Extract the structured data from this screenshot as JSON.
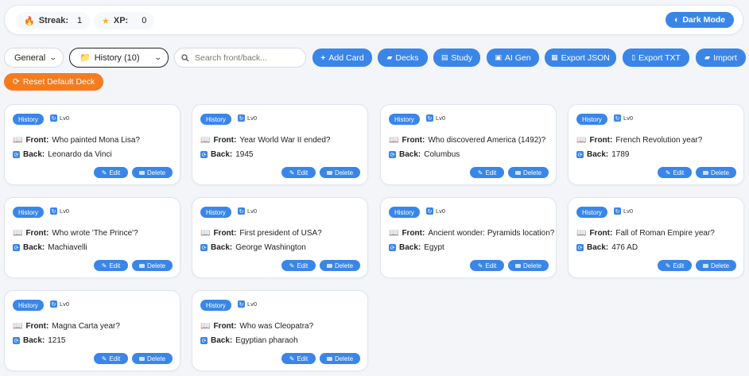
{
  "topbar": {
    "streak": {
      "icon": "fire-icon",
      "label": "Streak:",
      "value": "1"
    },
    "xp": {
      "icon": "star-icon",
      "label": "XP:",
      "value": "0"
    },
    "dark_mode": {
      "icon": "half-moon-icon",
      "label": "Dark Mode"
    }
  },
  "toolbar": {
    "category_select": "General",
    "deck_select": "History (10)",
    "search_placeholder": "Search front/back...",
    "buttons": {
      "add_card": "Add Card",
      "decks": "Decks",
      "study": "Study",
      "ai_gen": "AI Gen",
      "export_json": "Export JSON",
      "export_txt": "Export TXT",
      "import": "Import"
    },
    "reset": "Reset Default Deck"
  },
  "card_labels": {
    "front": "Front:",
    "back": "Back:",
    "edit": "Edit",
    "delete": "Delete"
  },
  "colors": {
    "accent": "#3a86e8",
    "reset": "#f47c1f",
    "background": "#f3f5f9"
  },
  "cards": [
    {
      "tag": "History",
      "level": "Lv0",
      "front": "Who painted Mona Lisa?",
      "back": "Leonardo da Vinci"
    },
    {
      "tag": "History",
      "level": "Lv0",
      "front": "Year World War II ended?",
      "back": "1945"
    },
    {
      "tag": "History",
      "level": "Lv0",
      "front": "Who discovered America (1492)?",
      "back": "Columbus"
    },
    {
      "tag": "History",
      "level": "Lv0",
      "front": "French Revolution year?",
      "back": "1789"
    },
    {
      "tag": "History",
      "level": "Lv0",
      "front": "Who wrote 'The Prince'?",
      "back": "Machiavelli"
    },
    {
      "tag": "History",
      "level": "Lv0",
      "front": "First president of USA?",
      "back": "George Washington"
    },
    {
      "tag": "History",
      "level": "Lv0",
      "front": "Ancient wonder: Pyramids location?",
      "back": "Egypt"
    },
    {
      "tag": "History",
      "level": "Lv0",
      "front": "Fall of Roman Empire year?",
      "back": "476 AD"
    },
    {
      "tag": "History",
      "level": "Lv0",
      "front": "Magna Carta year?",
      "back": "1215"
    },
    {
      "tag": "History",
      "level": "Lv0",
      "front": "Who was Cleopatra?",
      "back": "Egyptian pharaoh"
    }
  ]
}
